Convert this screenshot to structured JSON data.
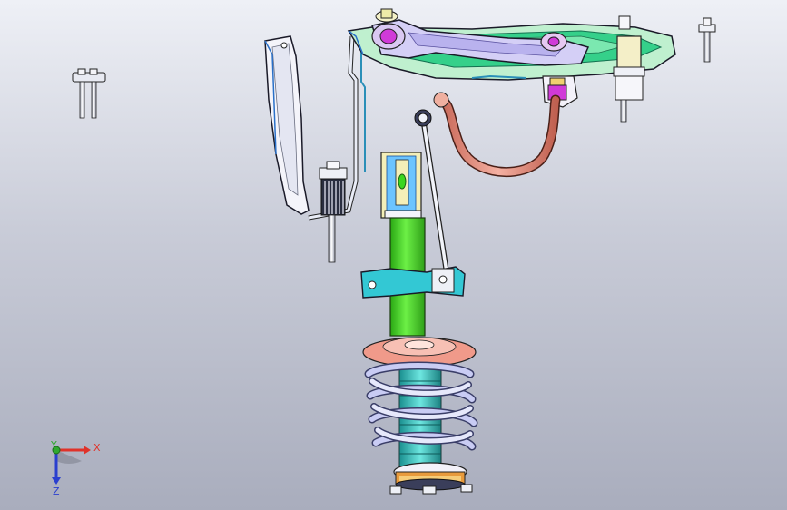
{
  "viewport": {
    "background_top": "#eef0f6",
    "background_bottom": "#a9adbd"
  },
  "triad": {
    "x_label": "X",
    "y_label": "Y",
    "z_label": "Z",
    "x_color": "#e0322a",
    "y_color": "#2fa82f",
    "z_color": "#2a3fcf"
  },
  "parts": {
    "coil_spring_color": "#8a8fe0",
    "damper_body_color": "#3bd61e",
    "spring_seat_color": "#f09a8a",
    "bumper_stop_color": "#3fc8c8",
    "control_arm_color": "#b9b2ee",
    "subframe_color": "#35d08a",
    "hose_color": "#e08878",
    "bracket_color": "#f4f1c8",
    "bushing_color": "#d03ad8"
  }
}
